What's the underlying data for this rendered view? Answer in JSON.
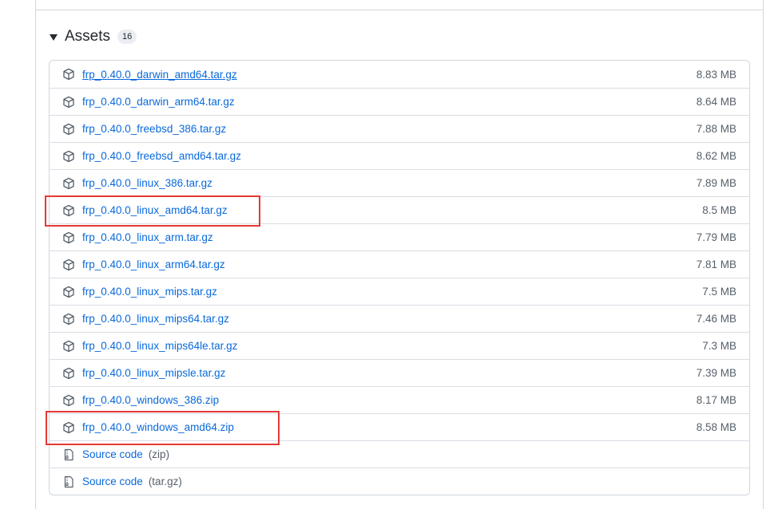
{
  "assets": {
    "title": "Assets",
    "count": "16",
    "items": [
      {
        "name": "frp_0.40.0_darwin_amd64.tar.gz",
        "size": "8.83 MB",
        "icon": "package-icon"
      },
      {
        "name": "frp_0.40.0_darwin_arm64.tar.gz",
        "size": "8.64 MB",
        "icon": "package-icon"
      },
      {
        "name": "frp_0.40.0_freebsd_386.tar.gz",
        "size": "7.88 MB",
        "icon": "package-icon"
      },
      {
        "name": "frp_0.40.0_freebsd_amd64.tar.gz",
        "size": "8.62 MB",
        "icon": "package-icon"
      },
      {
        "name": "frp_0.40.0_linux_386.tar.gz",
        "size": "7.89 MB",
        "icon": "package-icon"
      },
      {
        "name": "frp_0.40.0_linux_amd64.tar.gz",
        "size": "8.5 MB",
        "icon": "package-icon"
      },
      {
        "name": "frp_0.40.0_linux_arm.tar.gz",
        "size": "7.79 MB",
        "icon": "package-icon"
      },
      {
        "name": "frp_0.40.0_linux_arm64.tar.gz",
        "size": "7.81 MB",
        "icon": "package-icon"
      },
      {
        "name": "frp_0.40.0_linux_mips.tar.gz",
        "size": "7.5 MB",
        "icon": "package-icon"
      },
      {
        "name": "frp_0.40.0_linux_mips64.tar.gz",
        "size": "7.46 MB",
        "icon": "package-icon"
      },
      {
        "name": "frp_0.40.0_linux_mips64le.tar.gz",
        "size": "7.3 MB",
        "icon": "package-icon"
      },
      {
        "name": "frp_0.40.0_linux_mipsle.tar.gz",
        "size": "7.39 MB",
        "icon": "package-icon"
      },
      {
        "name": "frp_0.40.0_windows_386.zip",
        "size": "8.17 MB",
        "icon": "package-icon"
      },
      {
        "name": "frp_0.40.0_windows_amd64.zip",
        "size": "8.58 MB",
        "icon": "package-icon"
      }
    ],
    "source": [
      {
        "label": "Source code",
        "suffix": "(zip)",
        "icon": "file-zip-icon"
      },
      {
        "label": "Source code",
        "suffix": "(tar.gz)",
        "icon": "file-zip-icon"
      }
    ]
  },
  "highlight_color": "#e53935",
  "link_color": "#0969da"
}
